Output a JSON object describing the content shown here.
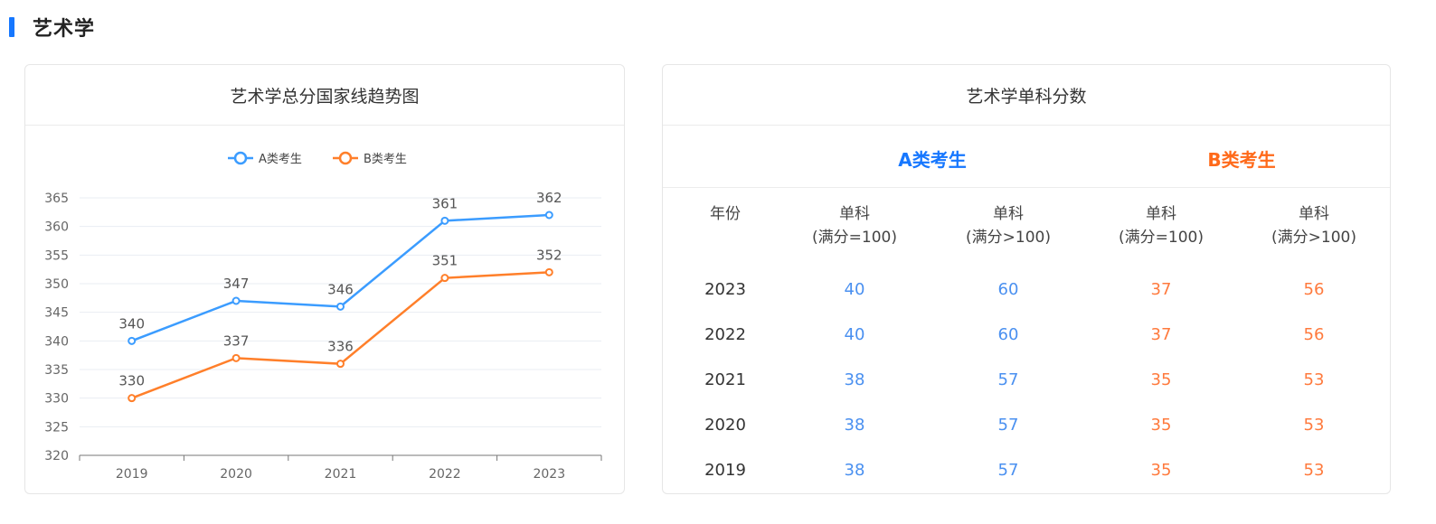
{
  "section": {
    "title": "艺术学"
  },
  "chart_card": {
    "title": "艺术学总分国家线趋势图"
  },
  "chart_data": {
    "type": "line",
    "title": "艺术学总分国家线趋势图",
    "categories": [
      "2019",
      "2020",
      "2021",
      "2022",
      "2023"
    ],
    "series": [
      {
        "name": "A类考生",
        "color": "#3b9cff",
        "values": [
          340,
          347,
          346,
          361,
          362
        ]
      },
      {
        "name": "B类考生",
        "color": "#ff7f2a",
        "values": [
          330,
          337,
          336,
          351,
          352
        ]
      }
    ],
    "ylim": [
      320,
      365
    ],
    "yticks": [
      320,
      325,
      330,
      335,
      340,
      345,
      350,
      355,
      360,
      365
    ],
    "legend": "top-center",
    "grid": true,
    "data_labels": true
  },
  "table_card": {
    "title": "艺术学单科分数",
    "group_a": "A类考生",
    "group_b": "B类考生",
    "year_header": "年份",
    "col_headers": [
      {
        "line1": "单科",
        "line2": "(满分=100)"
      },
      {
        "line1": "单科",
        "line2": "(满分>100)"
      },
      {
        "line1": "单科",
        "line2": "(满分=100)"
      },
      {
        "line1": "单科",
        "line2": "(满分>100)"
      }
    ],
    "rows": [
      {
        "year": "2023",
        "a1": "40",
        "a2": "60",
        "b1": "37",
        "b2": "56"
      },
      {
        "year": "2022",
        "a1": "40",
        "a2": "60",
        "b1": "37",
        "b2": "56"
      },
      {
        "year": "2021",
        "a1": "38",
        "a2": "57",
        "b1": "35",
        "b2": "53"
      },
      {
        "year": "2020",
        "a1": "38",
        "a2": "57",
        "b1": "35",
        "b2": "53"
      },
      {
        "year": "2019",
        "a1": "38",
        "a2": "57",
        "b1": "35",
        "b2": "53"
      }
    ]
  }
}
